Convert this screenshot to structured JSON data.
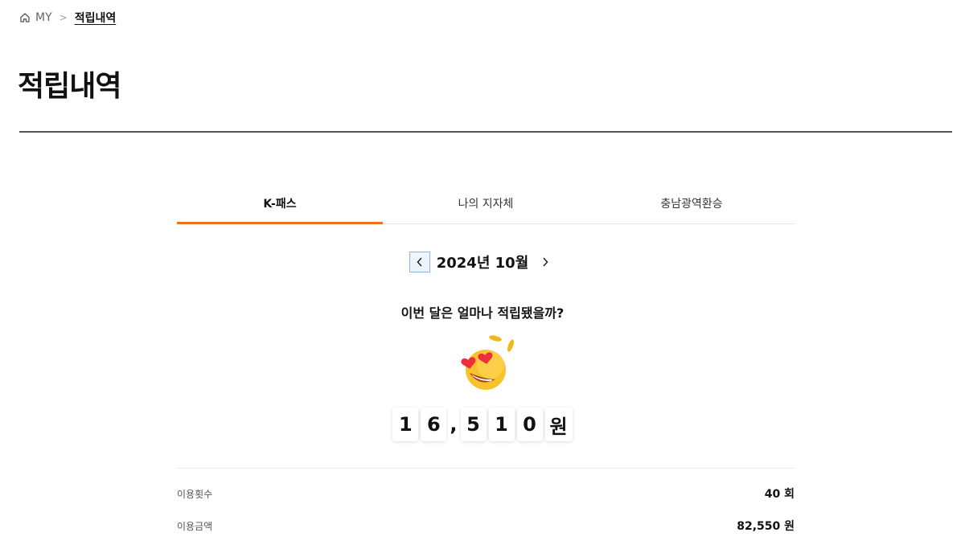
{
  "breadcrumb": {
    "home_icon": "home-icon",
    "parent": "MY",
    "separator": ">",
    "current": "적립내역"
  },
  "page_title": "적립내역",
  "tabs": [
    {
      "label": "K-패스",
      "active": true
    },
    {
      "label": "나의 지자체",
      "active": false
    },
    {
      "label": "충남광역환승",
      "active": false
    }
  ],
  "month_nav": {
    "prev_icon": "chevron-left-icon",
    "label": "2024년 10월",
    "next_icon": "chevron-right-icon"
  },
  "question": "이번 달은 얼마나 적립됐을까?",
  "emoji": "heart-eyes-coins-icon",
  "counter": {
    "chars": [
      "1",
      "6",
      ",",
      "5",
      "1",
      "0",
      "원"
    ]
  },
  "stats": [
    {
      "label": "이용횟수",
      "value": "40 회"
    },
    {
      "label": "이용금액",
      "value": "82,550 원"
    }
  ],
  "colors": {
    "accent": "#f07218",
    "title_rule": "#555555",
    "prev_button_border": "#8fb4e0"
  }
}
